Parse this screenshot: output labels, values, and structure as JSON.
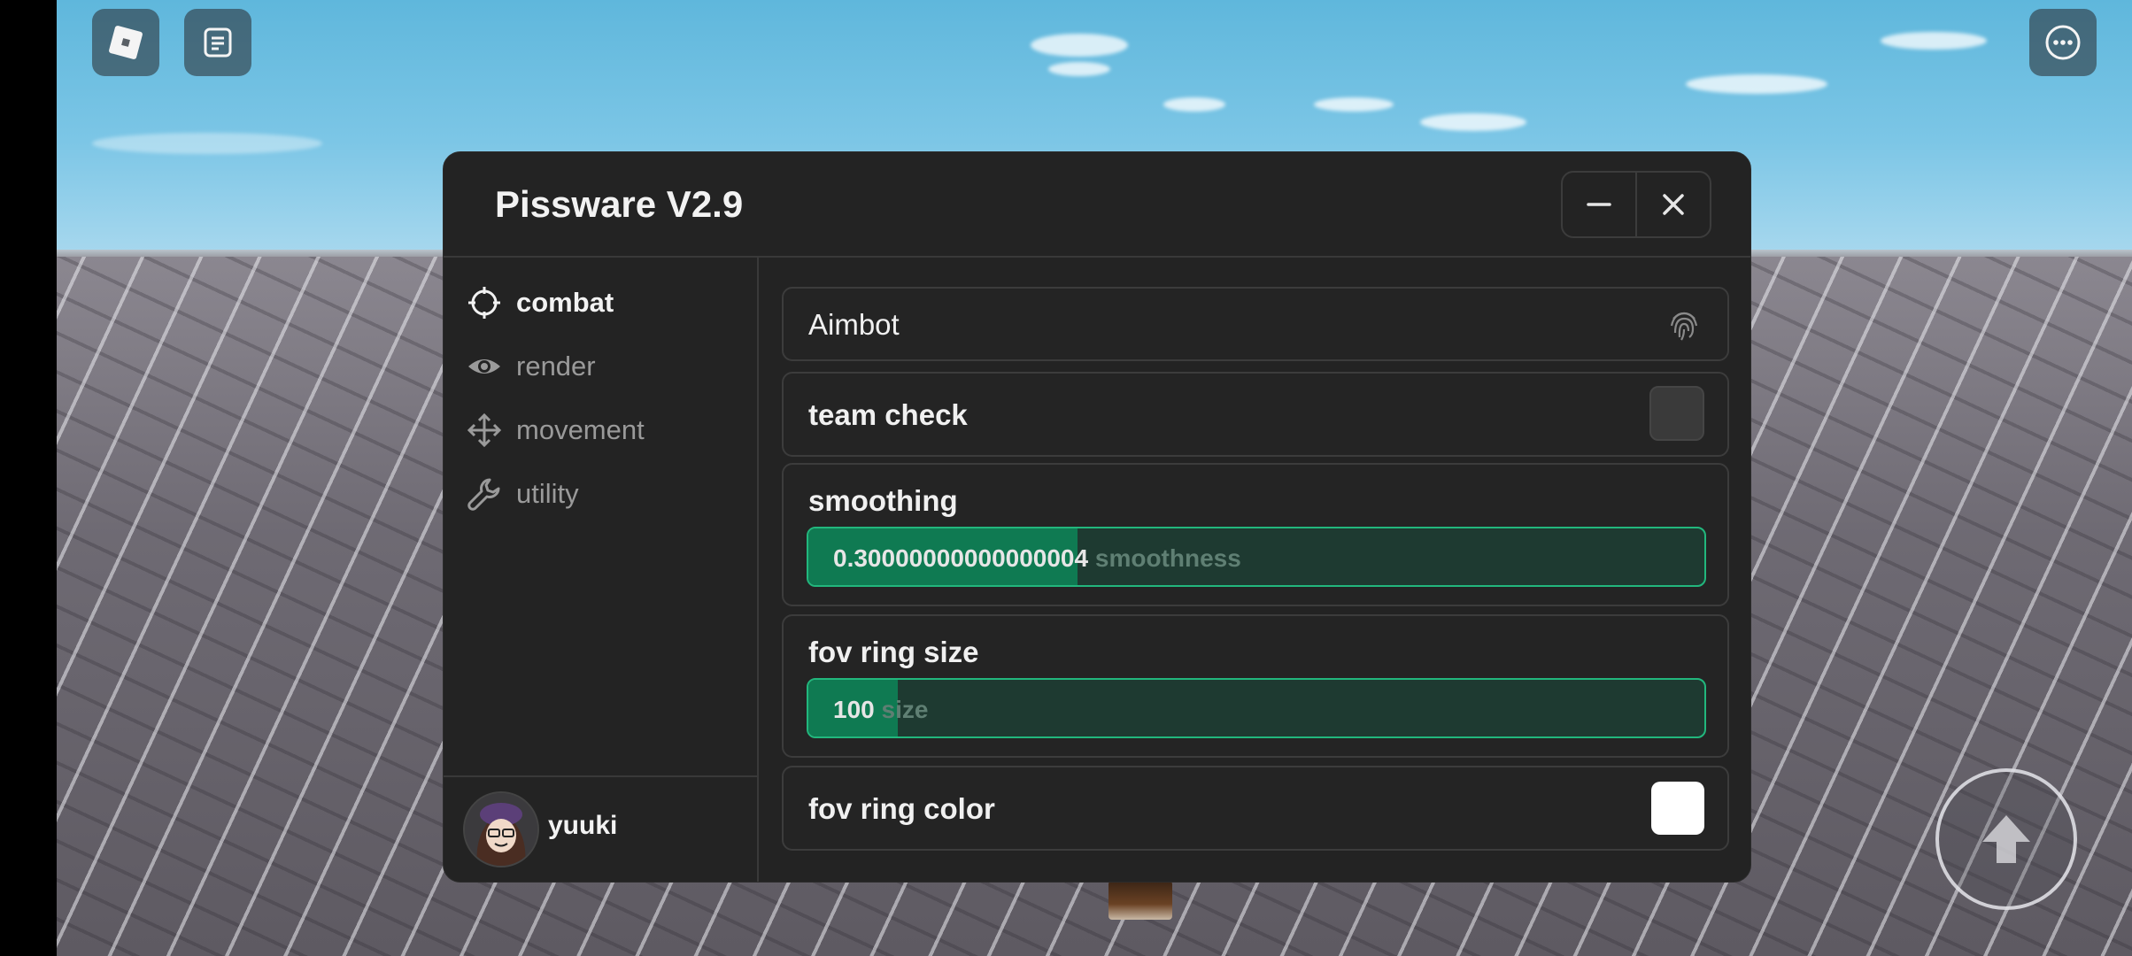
{
  "window": {
    "title": "Pissware V2.9"
  },
  "sidebar": {
    "items": [
      {
        "label": "combat",
        "icon": "crosshair-icon",
        "active": true
      },
      {
        "label": "render",
        "icon": "eye-icon",
        "active": false
      },
      {
        "label": "movement",
        "icon": "move-arrows-icon",
        "active": false
      },
      {
        "label": "utility",
        "icon": "wrench-icon",
        "active": false
      }
    ]
  },
  "user": {
    "name": "yuuki"
  },
  "combat": {
    "aimbot": {
      "label": "Aimbot",
      "icon": "fingerprint-icon"
    },
    "team_check": {
      "label": "team check",
      "checked": false
    },
    "smoothing": {
      "label": "smoothing",
      "value_text": "0.30000000000000004",
      "suffix": " smoothness",
      "fill_fraction": 0.3
    },
    "fov_ring_size": {
      "label": "fov ring size",
      "value_text": "100",
      "suffix": " size",
      "fill_fraction": 0.1
    },
    "fov_ring_color": {
      "label": "fov ring color",
      "color": "#ffffff"
    }
  },
  "colors": {
    "accent": "#22b77d",
    "panel": "#232323"
  }
}
